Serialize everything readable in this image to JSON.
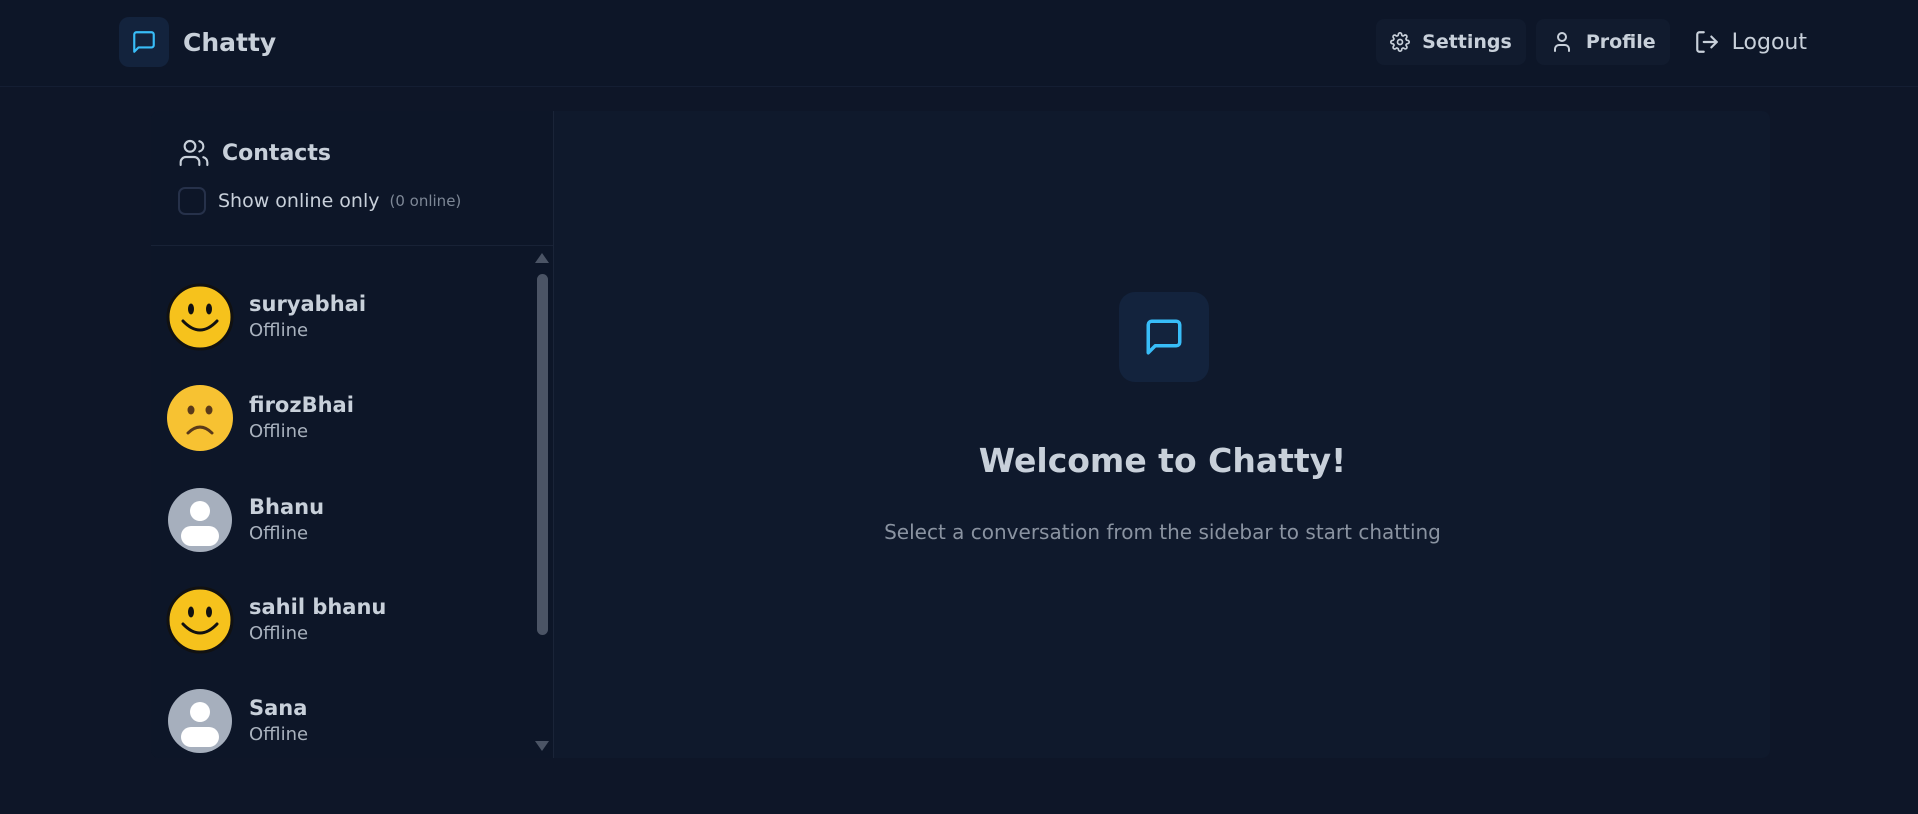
{
  "app": {
    "name": "Chatty"
  },
  "nav": {
    "settings_label": "Settings",
    "profile_label": "Profile",
    "logout_label": "Logout"
  },
  "sidebar": {
    "title": "Contacts",
    "filter_label": "Show online only",
    "online_count": "(0 online)",
    "contacts": [
      {
        "name": "suryabhai",
        "status": "Offline",
        "avatar": "smiley-face"
      },
      {
        "name": "firozBhai",
        "status": "Offline",
        "avatar": "frowning-face"
      },
      {
        "name": "Bhanu",
        "status": "Offline",
        "avatar": "default-user"
      },
      {
        "name": "sahil bhanu",
        "status": "Offline",
        "avatar": "smiley-face"
      },
      {
        "name": "Sana",
        "status": "Offline",
        "avatar": "default-user"
      }
    ]
  },
  "welcome": {
    "title": "Welcome to Chatty!",
    "subtitle": "Select a conversation from the sidebar to start chatting"
  },
  "colors": {
    "background": "#0e1628",
    "accent": "#38bdf8",
    "icon_tile": "#13233d",
    "text": "#c8d0da",
    "muted_text": "#8a93a1"
  }
}
